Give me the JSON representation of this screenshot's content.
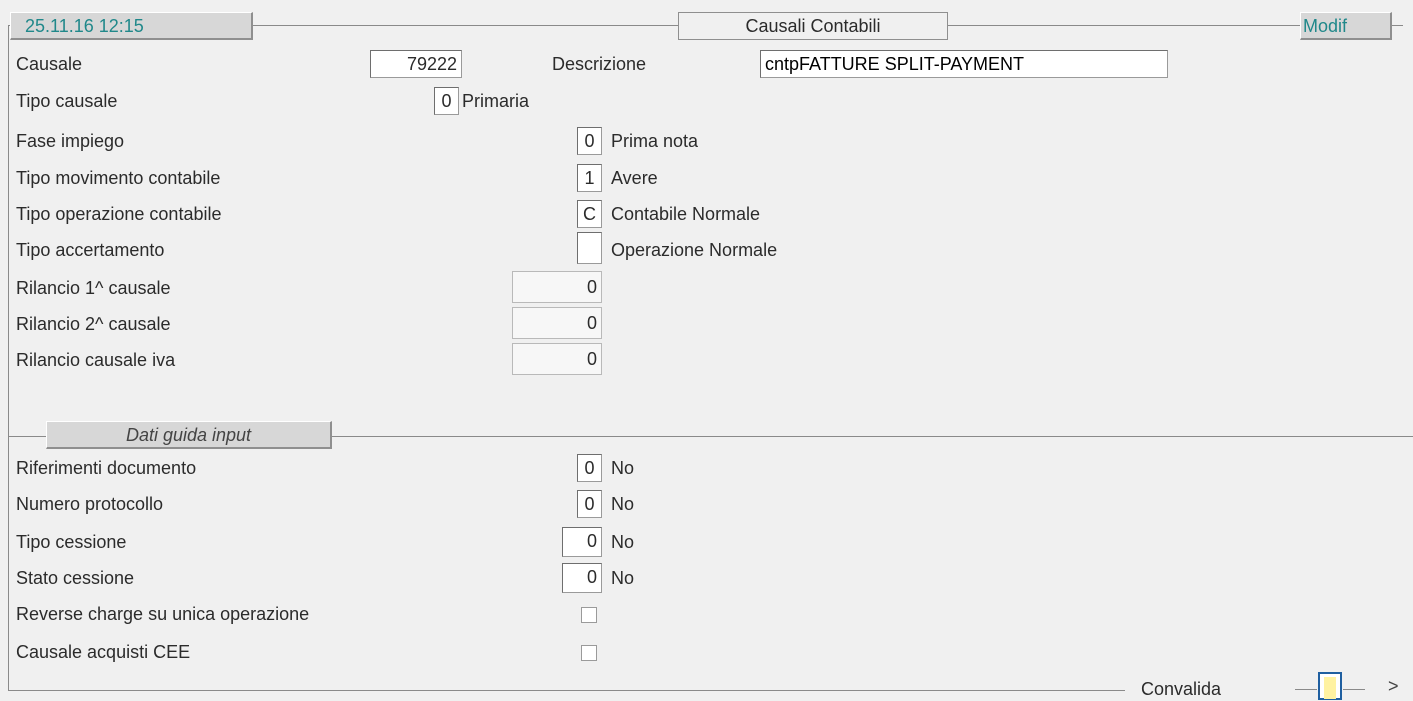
{
  "header": {
    "timestamp": "25.11.16 12:15",
    "title": "Causali Contabili",
    "mode": "Modif"
  },
  "causale": {
    "label": "Causale",
    "value": "79222",
    "descrizione_label": "Descrizione",
    "descrizione_value": "cntpFATTURE SPLIT-PAYMENT"
  },
  "tipo_causale": {
    "label": "Tipo causale",
    "value": "0",
    "desc": "Primaria"
  },
  "fase_impiego": {
    "label": "Fase impiego",
    "value": "0",
    "desc": "Prima nota"
  },
  "tipo_movimento": {
    "label": "Tipo movimento contabile",
    "value": "1",
    "desc": "Avere"
  },
  "tipo_operazione": {
    "label": "Tipo operazione contabile",
    "value": "C",
    "desc": "Contabile Normale"
  },
  "tipo_accertamento": {
    "label": "Tipo accertamento",
    "value": "",
    "desc": "Operazione Normale"
  },
  "rilancio1": {
    "label": "Rilancio 1^ causale",
    "value": "0"
  },
  "rilancio2": {
    "label": "Rilancio 2^ causale",
    "value": "0"
  },
  "rilancio_iva": {
    "label": "Rilancio causale iva",
    "value": "0"
  },
  "section_dati": {
    "title": "Dati guida input"
  },
  "riferimenti": {
    "label": "Riferimenti documento",
    "value": "0",
    "desc": "No"
  },
  "protocollo": {
    "label": "Numero protocollo",
    "value": "0",
    "desc": "No"
  },
  "tipo_cessione": {
    "label": "Tipo cessione",
    "value": "0",
    "desc": "No"
  },
  "stato_cessione": {
    "label": "Stato cessione",
    "value": "0",
    "desc": "No"
  },
  "reverse_charge": {
    "label": "Reverse charge su unica operazione",
    "checked": false
  },
  "acquisti_cee": {
    "label": "Causale acquisti CEE",
    "checked": false
  },
  "footer": {
    "convalida_label": "Convalida",
    "next_label": ">"
  }
}
